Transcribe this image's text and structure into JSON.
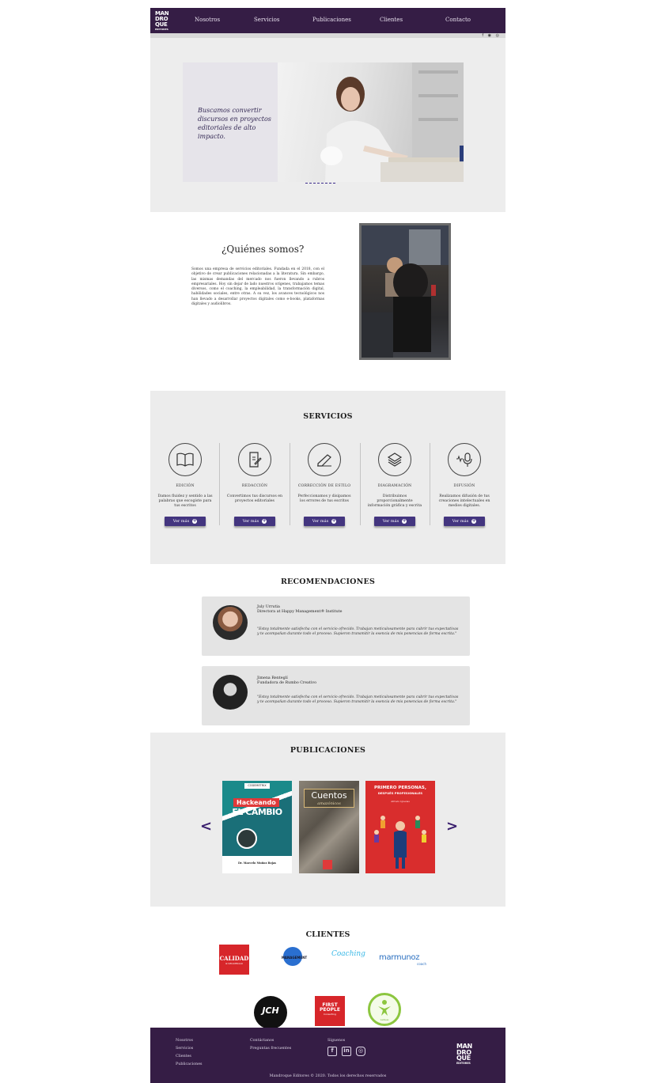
{
  "nav": {
    "logo_lines": [
      "MAN",
      "DRO",
      "QUE"
    ],
    "logo_sub": "EDITORES",
    "items": [
      "Nosotros",
      "Servicios",
      "Publicaciones",
      "Clientes",
      "Contacto"
    ]
  },
  "hero": {
    "tagline": "Buscamos convertir discursos en proyectos editoriales de alto impacto."
  },
  "about": {
    "title": "¿Quiénes somos?",
    "body": "Somos una empresa de servicios editoriales. Fundada en el 2018, con el objetivo de crear publicaciones relacionadas a la literatura. Sin embargo, las mismas demandas del mercado nos fueron llevando a rubros empresariales. Hoy sin dejar de lado nuestros orígenes, trabajamos temas diversos, como el coaching, la empleabilidad, la transformación digital, habilidades sociales, entre otras. A su vez, los avances tecnológicos nos han llevado a desarrollar proyectos digitales como e-books, plataformas digitales y audiolibros."
  },
  "services": {
    "title": "SERVICIOS",
    "items": [
      {
        "name": "EDICIÓN",
        "desc": "Damos fluidez y sentido a las palabras que escogiste para tus escritos",
        "button": "Ver más",
        "icon": "book-icon"
      },
      {
        "name": "REDACCIÓN",
        "desc": "Convertimos tus discursos en proyectos editoriales",
        "button": "Ver más",
        "icon": "document-edit-icon"
      },
      {
        "name": "CORRECCIÓN DE ESTILO",
        "desc": "Perfeccionamos y disipamos los errores de tus escritos",
        "button": "Ver más",
        "icon": "pen-writing-icon"
      },
      {
        "name": "DIAGRAMACIÓN",
        "desc": "Distribuimos proporcionalmente información gráfica y escrita",
        "button": "Ver más",
        "icon": "layers-icon"
      },
      {
        "name": "DIFUSIÓN",
        "desc": "Realizamos difusión de tus creaciones intelectuales en medios digitales.",
        "button": "Ver más",
        "icon": "microphone-icon"
      }
    ]
  },
  "recommendations": {
    "title": "RECOMENDACIONES",
    "items": [
      {
        "name": "July Urrutia",
        "role": "Directora at Happy Management® Institute",
        "quote_1": "\"Estoy totalmente satisfecha con el servicio ofrecido. Trabajan meticulosamente para cubrir tus expectativas",
        "quote_2": "y te acompañan durante todo el proceso. Supieron transmitir la esencia de mis ponencias de forma escrita.\""
      },
      {
        "name": "Jimena Renteglí",
        "role": "Fundadora de Rumbo Creativo",
        "quote_1": "\"Estoy totalmente satisfecha con el servicio ofrecido. Trabajan meticulosamente para cubrir tus expectativas",
        "quote_2": "y te acompañan durante todo el proceso. Supieron transmitir la esencia de mis ponencias de forma escrita.\""
      }
    ]
  },
  "publications": {
    "title": "PUBLICACIONES",
    "books": [
      {
        "top": "CODEMETRIX",
        "title_1": "Hackeando",
        "title_2": "EL CAMBIO",
        "author": "Dr. Marcelo Muñoz Rojas"
      },
      {
        "title": "Cuentos",
        "subtitle": "amazónicos"
      },
      {
        "title_1": "PRIMERO PERSONAS,",
        "title_2": "DESPUÉS PROFESIONALES",
        "author": "Alfredo Iglesias"
      }
    ]
  },
  "clients": {
    "title": "CLIENTES",
    "logos": [
      {
        "text": "CALIDAD",
        "sub": "& SEGURIDAD"
      },
      {
        "text": "MANAGEMENT"
      },
      {
        "text": "Coaching"
      },
      {
        "text": "marmunoz",
        "sub": "coach"
      },
      {
        "text": "JCH"
      },
      {
        "text_1": "FIRST",
        "text_2": "PEOPLE",
        "sub": "Consulting"
      },
      {
        "text": "wellness"
      }
    ]
  },
  "footer": {
    "col1": [
      "Nosotros",
      "Servicios",
      "Clientes",
      "Publicaciones"
    ],
    "col2": [
      "Contáctanos",
      "Preguntas frecuentes"
    ],
    "follow": "Síguenos",
    "copyright": "Mandroque Editores © 2020. Todos los derechos reservados"
  },
  "colors": {
    "nav": "#351d45",
    "accent": "#43357f",
    "section_bg": "#ececec"
  }
}
